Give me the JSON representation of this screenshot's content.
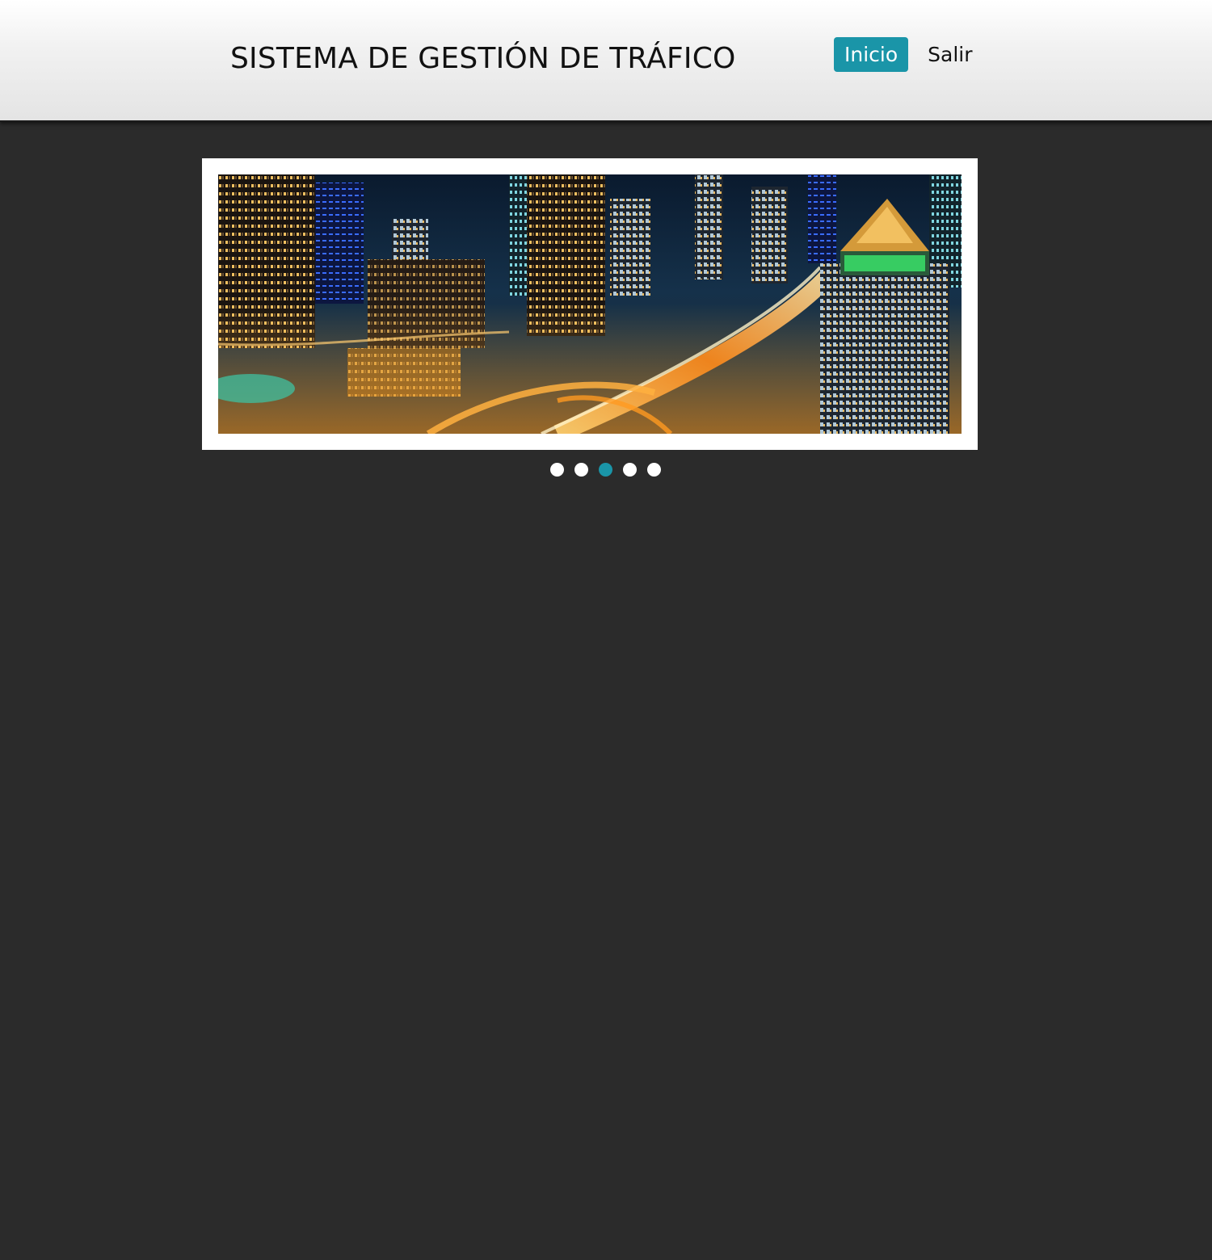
{
  "header": {
    "title": "SISTEMA DE GESTIÓN DE TRÁFICO",
    "nav": [
      {
        "label": "Inicio",
        "active": true
      },
      {
        "label": "Salir",
        "active": false
      }
    ]
  },
  "slider": {
    "image_alt": "",
    "dot_count": 5,
    "active_index": 2
  },
  "colors": {
    "accent": "#1a95a8",
    "page_background": "#2b2b2b",
    "header_gradient_top": "#ffffff",
    "header_gradient_bottom": "#e4e4e4"
  }
}
